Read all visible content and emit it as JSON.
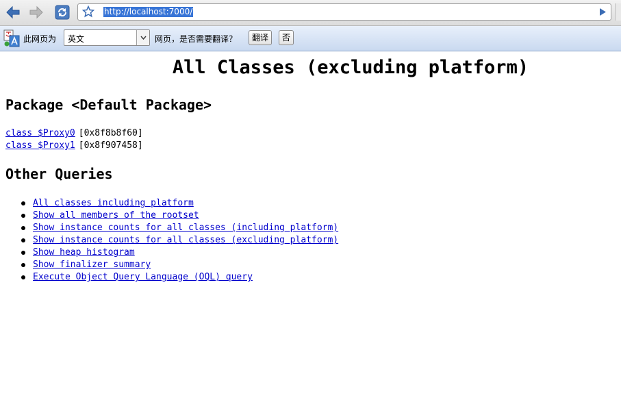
{
  "browser": {
    "url": "http://localhost:7000/"
  },
  "translate_bar": {
    "prefix": "此网页为",
    "language": "英文",
    "question": "网页，是否需要翻译？",
    "translate_button": "翻译",
    "no_button": "否"
  },
  "page": {
    "title": "All Classes (excluding platform)",
    "package_heading": "Package <Default Package>",
    "classes": [
      {
        "name": "class $Proxy0",
        "address": "[0x8f8b8f60]"
      },
      {
        "name": "class $Proxy1",
        "address": "[0x8f907458]"
      }
    ],
    "other_queries_heading": "Other Queries",
    "queries": [
      "All classes including platform",
      "Show all members of the rootset",
      "Show instance counts for all classes (including platform)",
      "Show instance counts for all classes (excluding platform)",
      "Show heap histogram",
      "Show finalizer summary",
      "Execute Object Query Language (OQL) query"
    ]
  },
  "colors": {
    "link": "#0000cc",
    "url_selection": "#3875d7",
    "infobar": "#c9d9f0"
  }
}
